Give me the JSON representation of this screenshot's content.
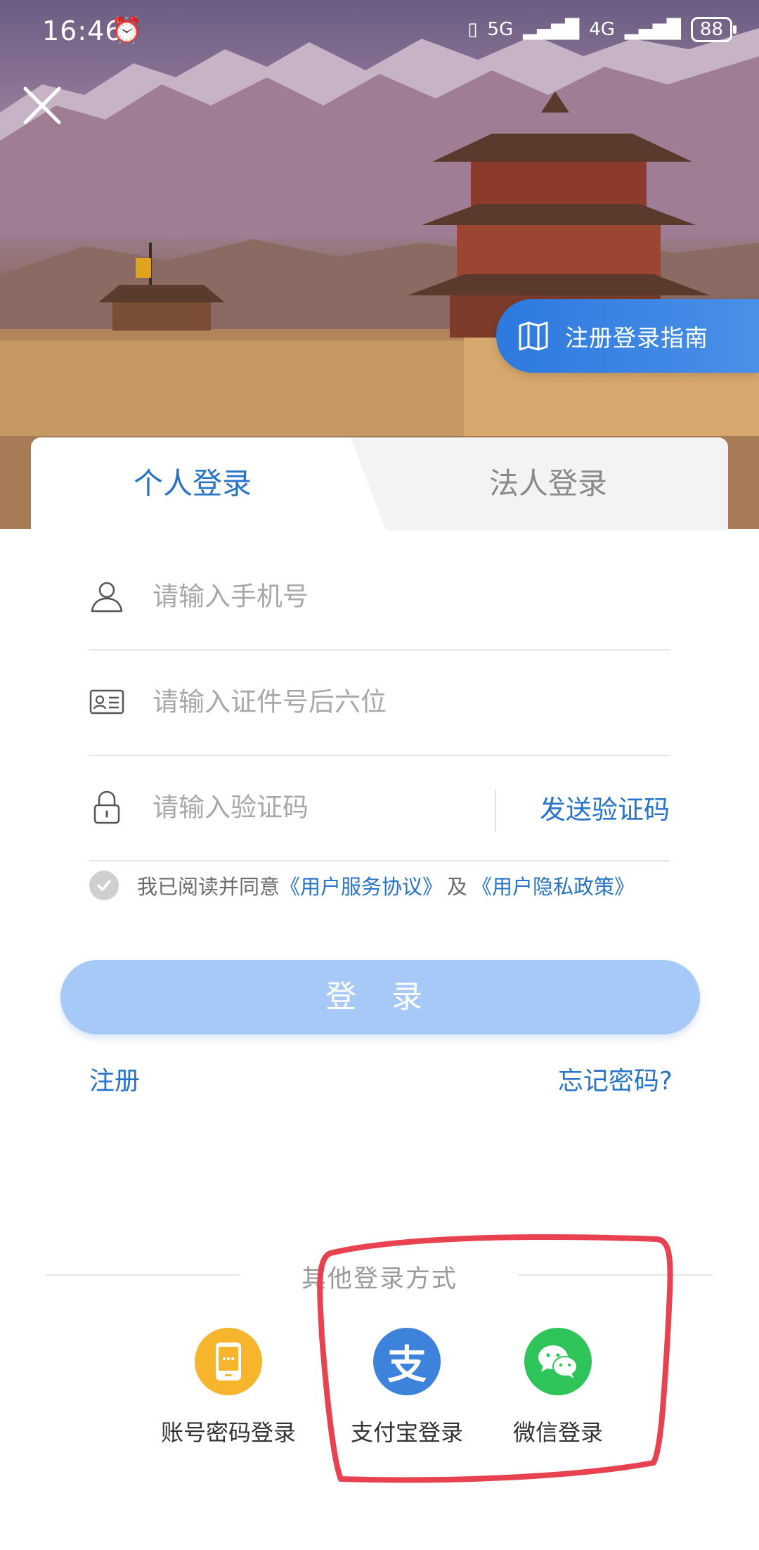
{
  "status_bar": {
    "time": "16:46",
    "alarm_icon": "alarm-icon",
    "network_5g": "5G",
    "network_4g": "4G",
    "battery": "88"
  },
  "hero": {
    "guide_label": "注册登录指南"
  },
  "tabs": [
    {
      "label": "个人登录",
      "active": true
    },
    {
      "label": "法人登录",
      "active": false
    }
  ],
  "form": {
    "phone_placeholder": "请输入手机号",
    "id_placeholder": "请输入证件号后六位",
    "code_placeholder": "请输入验证码",
    "send_code_label": "发送验证码"
  },
  "agreement": {
    "prefix": "我已阅读并同意",
    "service_link": "《用户服务协议》",
    "conjunction": "及",
    "privacy_link": "《用户隐私政策》"
  },
  "actions": {
    "login_label": "登 录",
    "register_label": "注册",
    "forgot_label": "忘记密码?"
  },
  "other_login": {
    "title": "其他登录方式",
    "methods": [
      {
        "label": "账号密码登录",
        "icon": "phone-icon",
        "color": "#f7b52d"
      },
      {
        "label": "支付宝登录",
        "icon": "alipay-icon",
        "color": "#3d82db"
      },
      {
        "label": "微信登录",
        "icon": "wechat-icon",
        "color": "#2fc45a"
      }
    ]
  },
  "colors": {
    "accent": "#2673c8",
    "login_button": "#a7c9f8",
    "highlight": "#e8414f"
  }
}
